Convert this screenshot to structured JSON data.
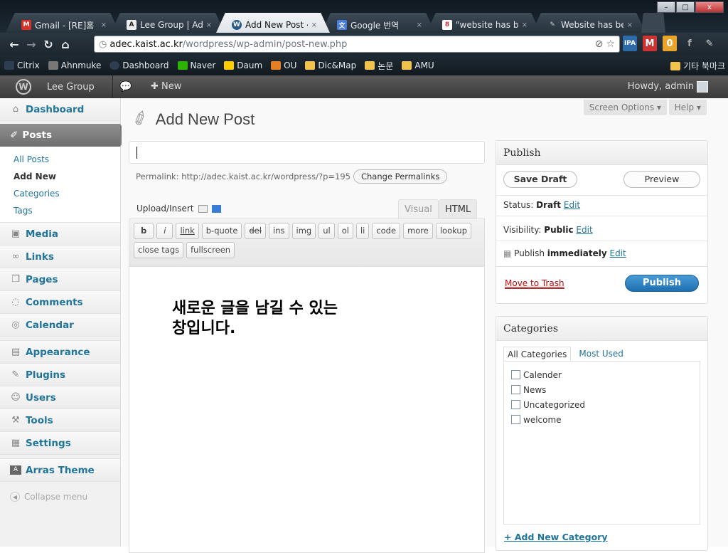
{
  "browser": {
    "window_controls": [
      "–",
      "□",
      "x"
    ],
    "tabs": [
      {
        "label": "Gmail - [RE]홈",
        "icon": "gmail-icon",
        "color": "#d93025"
      },
      {
        "label": "Lee Group | Ad",
        "icon": "arras-icon",
        "color": "#555555"
      },
      {
        "label": "Add New Post ‹",
        "icon": "wordpress-icon",
        "color": "#2a5a8a"
      },
      {
        "label": "Google 번역",
        "icon": "translate-icon",
        "color": "#4a7bd8"
      },
      {
        "label": "\"website has be",
        "icon": "google-icon",
        "color": "#e8a33a"
      },
      {
        "label": "Website has be",
        "icon": "plugin-icon",
        "color": "#888888"
      }
    ],
    "url_host": "adec.kaist.ac.kr",
    "url_path": "/wordpress/wp-admin/post-new.php",
    "bookmarks": [
      {
        "label": "Citrix",
        "color": "#2c3e50"
      },
      {
        "label": "Ahnmuke",
        "color": "#555555"
      },
      {
        "label": "Dashboard",
        "color": "#2c3e50"
      },
      {
        "label": "Naver",
        "color": "#2db400"
      },
      {
        "label": "Daum",
        "color": "#ffcc00"
      },
      {
        "label": "OU",
        "color": "#e67e22"
      },
      {
        "label": "Dic&Map",
        "color": "#f3c24b"
      },
      {
        "label": "논문",
        "color": "#f3c24b"
      },
      {
        "label": "AMU",
        "color": "#f3c24b"
      }
    ],
    "other_bookmarks": "기타 북마크"
  },
  "adminbar": {
    "site_name": "Lee Group",
    "new_label": "New",
    "howdy": "Howdy, admin"
  },
  "menu": {
    "dashboard": "Dashboard",
    "posts": "Posts",
    "posts_sub": [
      "All Posts",
      "Add New",
      "Categories",
      "Tags"
    ],
    "media": "Media",
    "links": "Links",
    "pages": "Pages",
    "comments": "Comments",
    "calendar": "Calendar",
    "appearance": "Appearance",
    "plugins": "Plugins",
    "users": "Users",
    "tools": "Tools",
    "settings": "Settings",
    "arras": "Arras Theme",
    "collapse": "Collapse menu"
  },
  "page": {
    "screen_options": "Screen Options",
    "help": "Help",
    "title": "Add New Post",
    "permalink_label": "Permalink: http://adec.kaist.ac.kr/wordpress/?p=195",
    "change_permalinks": "Change Permalinks",
    "upload_insert": "Upload/Insert",
    "tab_visual": "Visual",
    "tab_html": "HTML",
    "quicktags_row1": [
      "b",
      "i",
      "link",
      "b-quote",
      "del",
      "ins",
      "img",
      "ul",
      "ol",
      "li",
      "code",
      "more",
      "lookup"
    ],
    "quicktags_row2": [
      "close tags",
      "fullscreen"
    ],
    "editor_text_line1": "새로운 글을 남길 수 있는",
    "editor_text_line2": "창입니다."
  },
  "publish": {
    "title": "Publish",
    "save_draft": "Save Draft",
    "preview": "Preview",
    "status_label": "Status:",
    "status_value": "Draft",
    "visibility_label": "Visibility:",
    "visibility_value": "Public",
    "publish_label": "Publish",
    "publish_value": "immediately",
    "edit": "Edit",
    "move_to_trash": "Move to Trash",
    "publish_button": "Publish"
  },
  "categories": {
    "title": "Categories",
    "tab_all": "All Categories",
    "tab_most_used": "Most Used",
    "items": [
      "Calender",
      "News",
      "Uncategorized",
      "welcome"
    ],
    "add_new": "+ Add New Category"
  }
}
